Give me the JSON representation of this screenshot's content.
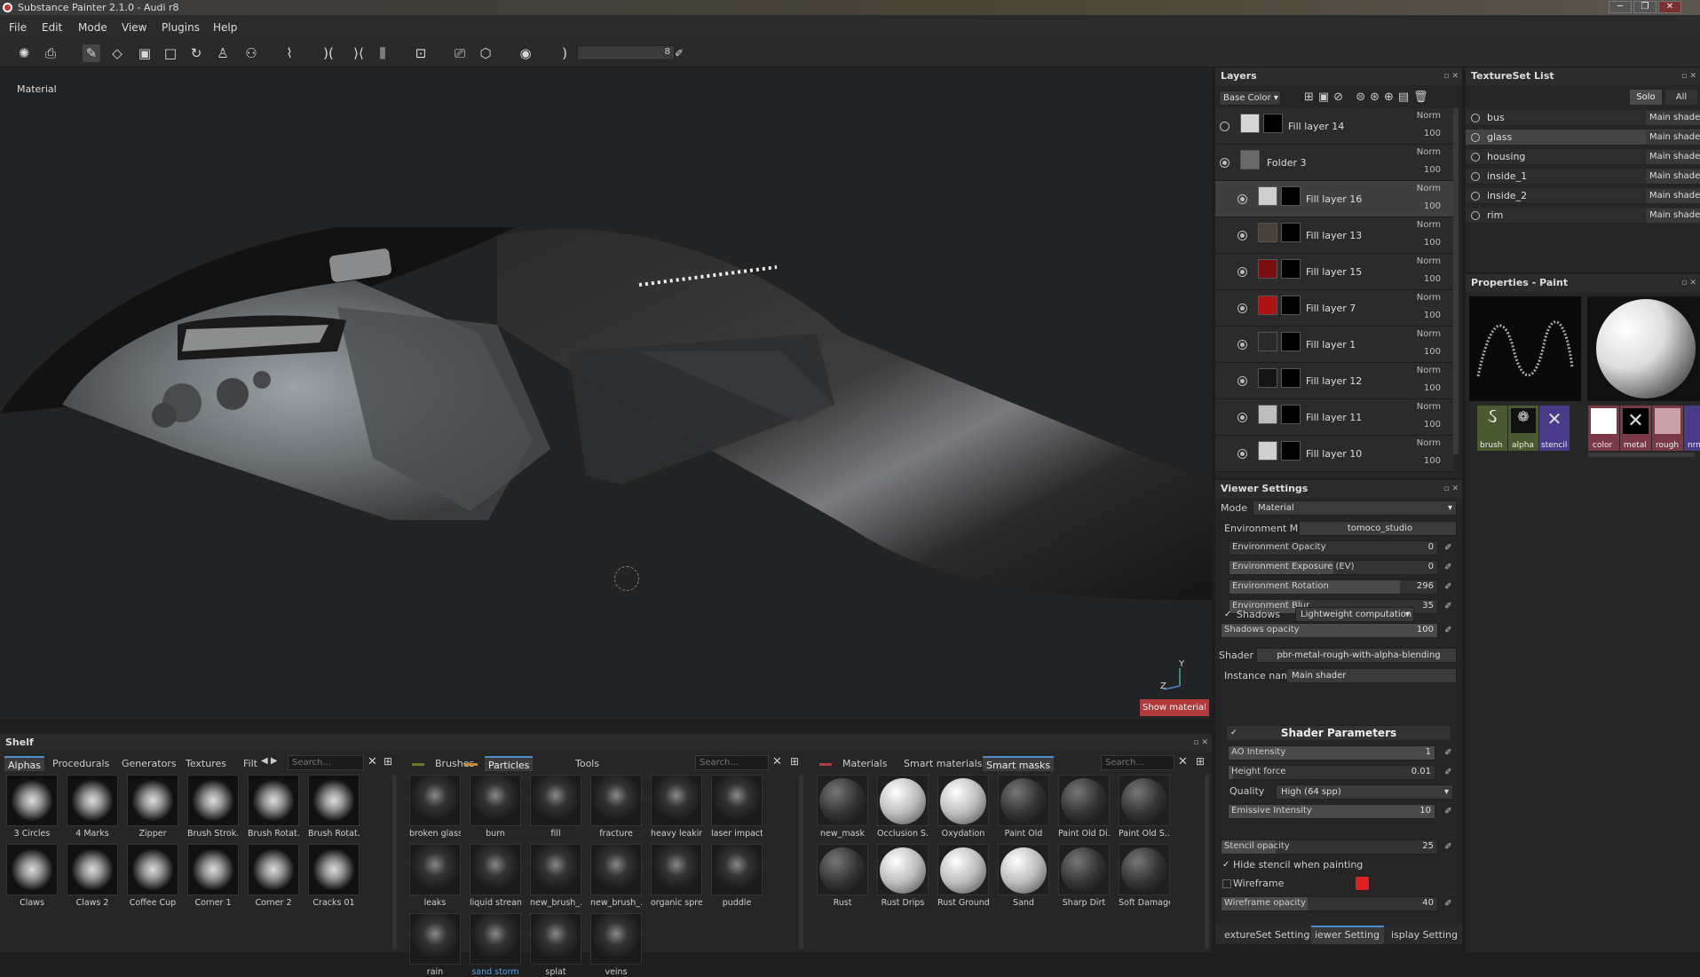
{
  "window": {
    "title": "Substance Painter 2.1.0 - Audi r8",
    "controls": [
      "─",
      "❐",
      "✕"
    ]
  },
  "menu": [
    "File",
    "Edit",
    "Mode",
    "View",
    "Plugins",
    "Help"
  ],
  "toolbar": {
    "brush_size": "8"
  },
  "viewport": {
    "mode_label": "Material",
    "show_material_button": "Show material",
    "axis_y": "Y",
    "axis_z": "Z"
  },
  "layers": {
    "title": "Layers",
    "channel": "Base Color",
    "rows": [
      {
        "name": "Fill layer 14",
        "blend": "Norm",
        "opacity": "100",
        "indent": 0,
        "color": "#d6d6d6",
        "selected": false,
        "visible": false
      },
      {
        "name": "Folder 3",
        "blend": "Norm",
        "opacity": "100",
        "indent": 0,
        "color": "#6a6a6a",
        "selected": false,
        "visible": true,
        "folder": true
      },
      {
        "name": "Fill layer 16",
        "blend": "Norm",
        "opacity": "100",
        "indent": 1,
        "color": "#cfcfcf",
        "selected": true,
        "visible": true
      },
      {
        "name": "Fill layer 13",
        "blend": "Norm",
        "opacity": "100",
        "indent": 1,
        "color": "#4a4038",
        "selected": false,
        "visible": true
      },
      {
        "name": "Fill layer 15",
        "blend": "Norm",
        "opacity": "100",
        "indent": 1,
        "color": "#7a0d0d",
        "selected": false,
        "visible": true
      },
      {
        "name": "Fill layer 7",
        "blend": "Norm",
        "opacity": "100",
        "indent": 1,
        "color": "#b01212",
        "selected": false,
        "visible": true
      },
      {
        "name": "Fill layer 1",
        "blend": "Norm",
        "opacity": "100",
        "indent": 1,
        "color": "#2a2a2a",
        "selected": false,
        "visible": true
      },
      {
        "name": "Fill layer 12",
        "blend": "Norm",
        "opacity": "100",
        "indent": 1,
        "color": "#151515",
        "selected": false,
        "visible": true
      },
      {
        "name": "Fill layer 11",
        "blend": "Norm",
        "opacity": "100",
        "indent": 1,
        "color": "#bdbdbd",
        "selected": false,
        "visible": true
      },
      {
        "name": "Fill layer 10",
        "blend": "Norm",
        "opacity": "100",
        "indent": 1,
        "color": "#cfcfcf",
        "selected": false,
        "visible": true
      }
    ]
  },
  "viewer": {
    "title": "Viewer Settings",
    "mode_label": "Mode",
    "mode_value": "Material",
    "env_map_label": "Environment Map",
    "env_map_value": "tomoco_studio",
    "sliders": [
      {
        "label": "Environment Opacity",
        "value": "0",
        "fill": 0.0
      },
      {
        "label": "Environment Exposure (EV)",
        "value": "0",
        "fill": 0.5
      },
      {
        "label": "Environment Rotation",
        "value": "296",
        "fill": 0.82
      },
      {
        "label": "Environment Blur",
        "value": "35",
        "fill": 0.35
      }
    ],
    "shadows_label": "Shadows",
    "shadows_value": "Lightweight computation",
    "shadows_opacity_label": "Shadows opacity",
    "shadows_opacity_value": "100",
    "shader_label": "Shader",
    "shader_value": "pbr-metal-rough-with-alpha-blending",
    "instance_label": "Instance name",
    "instance_value": "Main shader",
    "shader_params_title": "Shader Parameters",
    "ao_label": "AO Intensity",
    "ao_value": "1",
    "height_label": "Height force",
    "height_value": "0.01",
    "quality_label": "Quality",
    "quality_value": "High (64 spp)",
    "emissive_label": "Emissive Intensity",
    "emissive_value": "10",
    "stencil_label": "Stencil opacity",
    "stencil_value": "25",
    "hide_stencil_label": "Hide stencil when painting",
    "wireframe_label": "Wireframe",
    "wireframe_color": "#e02020",
    "wireframe_opacity_label": "Wireframe opacity",
    "wireframe_opacity_value": "40",
    "tabs": [
      "extureSet Setting",
      "iewer Setting",
      "isplay Setting"
    ]
  },
  "textureset": {
    "title": "TextureSet List",
    "solo": "Solo",
    "all": "All",
    "rows": [
      {
        "name": "bus",
        "shader": "Main shader",
        "selected": false
      },
      {
        "name": "glass",
        "shader": "Main shader",
        "selected": true
      },
      {
        "name": "housing",
        "shader": "Main shader",
        "selected": false
      },
      {
        "name": "inside_1",
        "shader": "Main shader",
        "selected": false
      },
      {
        "name": "inside_2",
        "shader": "Main shader",
        "selected": false
      },
      {
        "name": "rim",
        "shader": "Main shader",
        "selected": false
      }
    ]
  },
  "properties": {
    "title": "Properties - Paint",
    "slots": [
      "brush",
      "alpha",
      "stencil"
    ],
    "channels": [
      "color",
      "metal",
      "rough",
      "nrm"
    ]
  },
  "shelf": {
    "title": "Shelf",
    "tabs1": [
      "Alphas",
      "Procedurals",
      "Generators",
      "Textures",
      "Filt"
    ],
    "search1": "Search...",
    "alphas": [
      "3 Circles",
      "4 Marks",
      "Zipper",
      "Brush Strok...",
      "Brush Rotat...",
      "Brush Rotat...",
      "Claws",
      "Claws 2",
      "Coffee Cup",
      "Corner 1",
      "Corner 2",
      "Cracks 01"
    ],
    "tabs2": [
      "Brushes",
      "Particles",
      "Tools"
    ],
    "search2": "Search...",
    "particles": [
      "broken glass",
      "burn",
      "fill",
      "fracture",
      "heavy leaking",
      "laser impact",
      "leaks",
      "liquid stream",
      "new_brush_...",
      "new_brush_...",
      "organic spre...",
      "puddle",
      "rain",
      "sand storm",
      "splat",
      "veins"
    ],
    "tabs3": [
      "Materials",
      "Smart materials",
      "Smart masks"
    ],
    "search3": "Search...",
    "masks": [
      "new_mask",
      "Occlusion S...",
      "Oxydation",
      "Paint Old",
      "Paint Old Di...",
      "Paint Old S...",
      "Rust",
      "Rust Drips",
      "Rust Ground",
      "Sand",
      "Sharp Dirt",
      "Soft Damages"
    ]
  }
}
